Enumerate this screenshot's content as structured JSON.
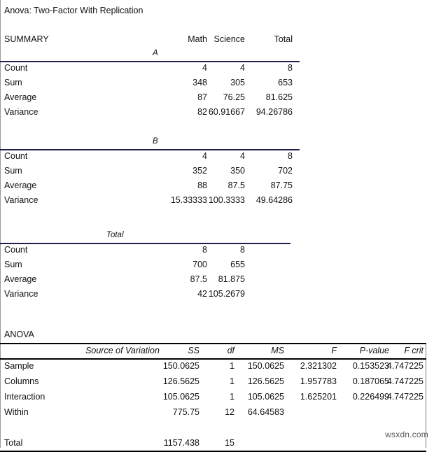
{
  "title": "Anova: Two-Factor With Replication",
  "summary": {
    "label": "SUMMARY",
    "columns": [
      "Math",
      "Science",
      "Total"
    ],
    "row_labels": [
      "Count",
      "Sum",
      "Average",
      "Variance"
    ],
    "groups": [
      {
        "name": "A",
        "count": [
          "4",
          "4",
          "8"
        ],
        "sum": [
          "348",
          "305",
          "653"
        ],
        "average": [
          "87",
          "76.25",
          "81.625"
        ],
        "variance": [
          "82",
          "60.91667",
          "94.26786"
        ]
      },
      {
        "name": "B",
        "count": [
          "4",
          "4",
          "8"
        ],
        "sum": [
          "352",
          "350",
          "702"
        ],
        "average": [
          "88",
          "87.5",
          "87.75"
        ],
        "variance": [
          "15.33333",
          "100.3333",
          "49.64286"
        ]
      },
      {
        "name": "Total",
        "count": [
          "8",
          "8",
          ""
        ],
        "sum": [
          "700",
          "655",
          ""
        ],
        "average": [
          "87.5",
          "81.875",
          ""
        ],
        "variance": [
          "42",
          "105.2679",
          ""
        ]
      }
    ]
  },
  "anova": {
    "label": "ANOVA",
    "columns": [
      "Source of Variation",
      "SS",
      "df",
      "MS",
      "F",
      "P-value",
      "F crit"
    ],
    "rows": [
      {
        "source": "Sample",
        "ss": "150.0625",
        "df": "1",
        "ms": "150.0625",
        "f": "2.321302",
        "p": "0.153523",
        "fcrit": "4.747225"
      },
      {
        "source": "Columns",
        "ss": "126.5625",
        "df": "1",
        "ms": "126.5625",
        "f": "1.957783",
        "p": "0.187065",
        "fcrit": "4.747225"
      },
      {
        "source": "Interaction",
        "ss": "105.0625",
        "df": "1",
        "ms": "105.0625",
        "f": "1.625201",
        "p": "0.226499",
        "fcrit": "4.747225"
      },
      {
        "source": "Within",
        "ss": "775.75",
        "df": "12",
        "ms": "64.64583",
        "f": "",
        "p": "",
        "fcrit": ""
      }
    ],
    "total": {
      "source": "Total",
      "ss": "1157.438",
      "df": "15",
      "ms": "",
      "f": "",
      "p": "",
      "fcrit": ""
    }
  },
  "watermark": "wsxdn.com",
  "colors": {
    "rule_navy": "#1f1f4d",
    "rule_black": "#000000",
    "text": "#111111",
    "watermark": "#5a5a5a"
  }
}
